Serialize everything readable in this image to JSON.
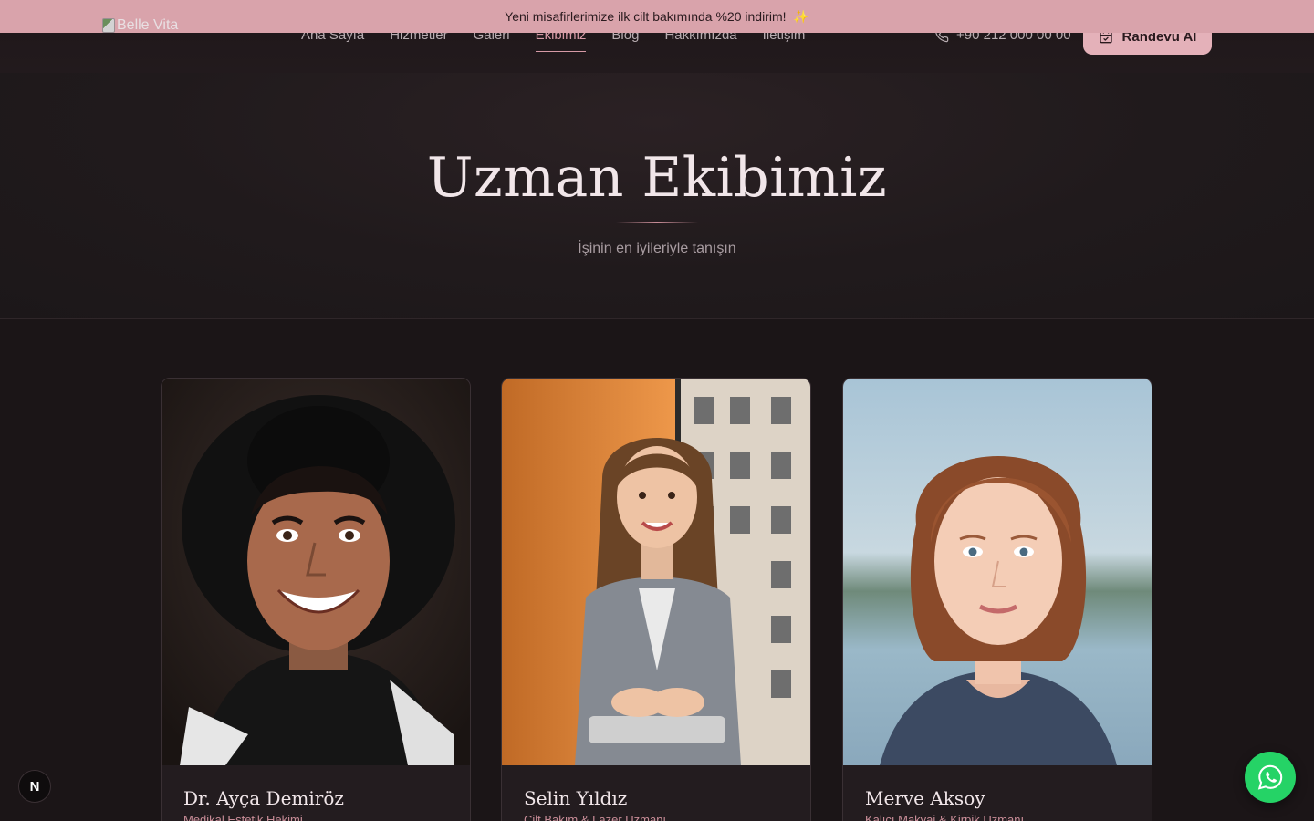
{
  "announcement": {
    "text": "Yeni misafirlerimize ilk cilt bakımında %20 indirim!",
    "emoji": "✨"
  },
  "brand": {
    "logo_alt": "Belle Vita"
  },
  "nav": {
    "items": [
      {
        "label": "Ana Sayfa",
        "active": false
      },
      {
        "label": "Hizmetler",
        "active": false
      },
      {
        "label": "Galeri",
        "active": false
      },
      {
        "label": "Ekibimiz",
        "active": true
      },
      {
        "label": "Blog",
        "active": false
      },
      {
        "label": "Hakkımızda",
        "active": false
      },
      {
        "label": "İletişim",
        "active": false
      }
    ],
    "phone": "+90 212 000 00 00",
    "cta_label": "Randevu Al"
  },
  "hero": {
    "title": "Uzman Ekibimiz",
    "subtitle": "İşinin en iyileriyle tanışın"
  },
  "team": [
    {
      "name": "Dr. Ayça Demiröz",
      "role": "Medikal Estetik Hekimi"
    },
    {
      "name": "Selin Yıldız",
      "role": "Cilt Bakım & Lazer Uzmanı"
    },
    {
      "name": "Merve Aksoy",
      "role": "Kalıcı Makyaj & Kirpik Uzmanı"
    }
  ],
  "floating": {
    "badge_letter": "N"
  },
  "colors": {
    "accent": "#e4b1b9",
    "announce_bg": "#d9a3ab",
    "bg": "#1a1416",
    "whatsapp": "#25d366"
  }
}
